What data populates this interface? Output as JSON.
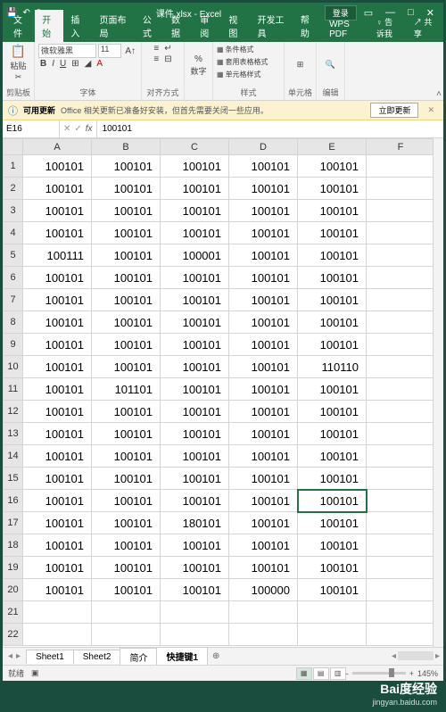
{
  "titlebar": {
    "filename": "课件.xlsx",
    "app": "Excel",
    "login": "登录"
  },
  "tabs": {
    "file": "文件",
    "home": "开始",
    "insert": "插入",
    "layout": "页面布局",
    "formulas": "公式",
    "data": "数据",
    "review": "审阅",
    "view": "视图",
    "dev": "开发工具",
    "help": "帮助",
    "wps": "WPS PDF",
    "tell": "告诉我",
    "share": "共享"
  },
  "ribbon": {
    "clipboard": "剪贴板",
    "paste": "粘贴",
    "font_label": "字体",
    "font_name": "微软雅黑",
    "font_size": "11",
    "align": "对齐方式",
    "number": "数字",
    "styles": "样式",
    "cond_fmt": "条件格式",
    "table_fmt": "套用表格格式",
    "cell_fmt": "单元格样式",
    "cells": "单元格",
    "edit": "编辑"
  },
  "notification": {
    "title": "可用更新",
    "message": "Office 相关更新已准备好安装，但首先需要关闭一些应用。",
    "action": "立即更新"
  },
  "formula_bar": {
    "cell_ref": "E16",
    "value": "100101"
  },
  "columns": [
    "A",
    "B",
    "C",
    "D",
    "E",
    "F"
  ],
  "rows": [
    [
      "100101",
      "100101",
      "100101",
      "100101",
      "100101"
    ],
    [
      "100101",
      "100101",
      "100101",
      "100101",
      "100101"
    ],
    [
      "100101",
      "100101",
      "100101",
      "100101",
      "100101"
    ],
    [
      "100101",
      "100101",
      "100101",
      "100101",
      "100101"
    ],
    [
      "100111",
      "100101",
      "100001",
      "100101",
      "100101"
    ],
    [
      "100101",
      "100101",
      "100101",
      "100101",
      "100101"
    ],
    [
      "100101",
      "100101",
      "100101",
      "100101",
      "100101"
    ],
    [
      "100101",
      "100101",
      "100101",
      "100101",
      "100101"
    ],
    [
      "100101",
      "100101",
      "100101",
      "100101",
      "100101"
    ],
    [
      "100101",
      "100101",
      "100101",
      "100101",
      "110110"
    ],
    [
      "100101",
      "101101",
      "100101",
      "100101",
      "100101"
    ],
    [
      "100101",
      "100101",
      "100101",
      "100101",
      "100101"
    ],
    [
      "100101",
      "100101",
      "100101",
      "100101",
      "100101"
    ],
    [
      "100101",
      "100101",
      "100101",
      "100101",
      "100101"
    ],
    [
      "100101",
      "100101",
      "100101",
      "100101",
      "100101"
    ],
    [
      "100101",
      "100101",
      "100101",
      "100101",
      "100101"
    ],
    [
      "100101",
      "100101",
      "180101",
      "100101",
      "100101"
    ],
    [
      "100101",
      "100101",
      "100101",
      "100101",
      "100101"
    ],
    [
      "100101",
      "100101",
      "100101",
      "100101",
      "100101"
    ],
    [
      "100101",
      "100101",
      "100101",
      "100000",
      "100101"
    ],
    [
      "",
      "",
      "",
      "",
      ""
    ],
    [
      "",
      "",
      "",
      "",
      ""
    ]
  ],
  "selected": {
    "row": 16,
    "col": 5
  },
  "sheets": {
    "s1": "Sheet1",
    "s2": "Sheet2",
    "s3": "简介",
    "s4": "快捷键1"
  },
  "status": {
    "ready": "就绪",
    "zoom": "145%"
  },
  "watermark": {
    "logo": "Bai度经验",
    "sub": "jingyan.baidu.com"
  }
}
